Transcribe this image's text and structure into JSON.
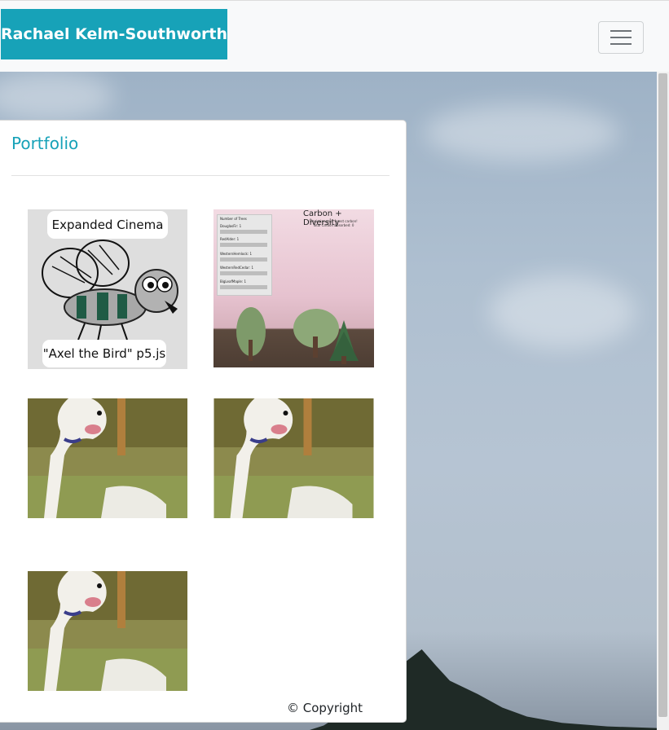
{
  "navbar": {
    "brand": "Rachael Kelm-Southworth",
    "toggler_icon": "hamburger-menu-icon"
  },
  "portfolio": {
    "title": "Portfolio",
    "items": [
      {
        "top_caption": "Expanded Cinema",
        "bottom_caption": "\"Axel the Bird\" p5.js",
        "type": "fly-illustration"
      },
      {
        "title": "Carbon + Diversity",
        "subtitle": "Maximize your forest carbon!",
        "subtitle2": "Total Carbon Absorbed: 0",
        "panel_heading": "Number of Trees",
        "sliders": [
          "DouglasFir: 1",
          "RedAlder: 1",
          "WesternHemlock: 1",
          "WesternRedCedar: 1",
          "BigLeafMaple: 1"
        ],
        "type": "forest-game"
      },
      {
        "type": "dog-photo"
      },
      {
        "type": "dog-photo"
      },
      {
        "type": "dog-photo"
      }
    ]
  },
  "footer": {
    "copyright": "© Copyright"
  },
  "colors": {
    "brand": "#17a2b8",
    "navbar_bg": "#f8f9fa",
    "card_bg": "#ffffff"
  }
}
